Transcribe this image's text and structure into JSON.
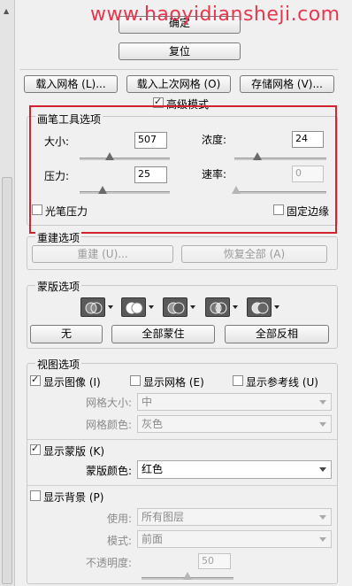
{
  "watermark": "www.haoyidiansheji.com",
  "colors": {
    "highlight_box": "#d4232f",
    "watermark": "#e8364f"
  },
  "top_buttons": {
    "ok": "确定",
    "reset": "复位"
  },
  "mesh_buttons": {
    "load_mesh": "载入网格 (L)...",
    "load_last_mesh": "载入上次网格 (O)",
    "save_mesh": "存储网格 (V)..."
  },
  "advanced_mode": {
    "label": "高级模式",
    "checked": true
  },
  "brush_tool": {
    "title": "画笔工具选项",
    "size": {
      "label": "大小:",
      "value": "507"
    },
    "density": {
      "label": "浓度:",
      "value": "24"
    },
    "pressure": {
      "label": "压力:",
      "value": "25"
    },
    "rate": {
      "label": "速率:",
      "value": "0"
    },
    "stylus": {
      "label": "光笔压力",
      "checked": false
    },
    "pin_edges": {
      "label": "固定边缘",
      "checked": false
    }
  },
  "reconstruct": {
    "title": "重建选项",
    "rebuild": "重建 (U)...",
    "restore_all": "恢复全部 (A)"
  },
  "mask": {
    "title": "蒙版选项",
    "icons": [
      "mask-replace-icon",
      "mask-add-icon",
      "mask-subtract-icon",
      "mask-intersect-icon",
      "mask-invert-icon"
    ],
    "none": "无",
    "mask_all": "全部蒙住",
    "invert_all": "全部反相"
  },
  "view": {
    "title": "视图选项",
    "show_image": {
      "label": "显示图像 (I)",
      "checked": true
    },
    "show_mesh": {
      "label": "显示网格 (E)",
      "checked": false
    },
    "show_guides": {
      "label": "显示参考线 (U)",
      "checked": false
    },
    "mesh_size": {
      "label": "网格大小:",
      "value": "中"
    },
    "mesh_color": {
      "label": "网格颜色:",
      "value": "灰色"
    },
    "show_mask": {
      "label": "显示蒙版 (K)",
      "checked": true
    },
    "mask_color": {
      "label": "蒙版颜色:",
      "value": "红色"
    },
    "show_backdrop": {
      "label": "显示背景 (P)",
      "checked": false
    },
    "use": {
      "label": "使用:",
      "value": "所有图层"
    },
    "mode": {
      "label": "模式:",
      "value": "前面"
    },
    "opacity": {
      "label": "不透明度:",
      "value": "50"
    }
  }
}
